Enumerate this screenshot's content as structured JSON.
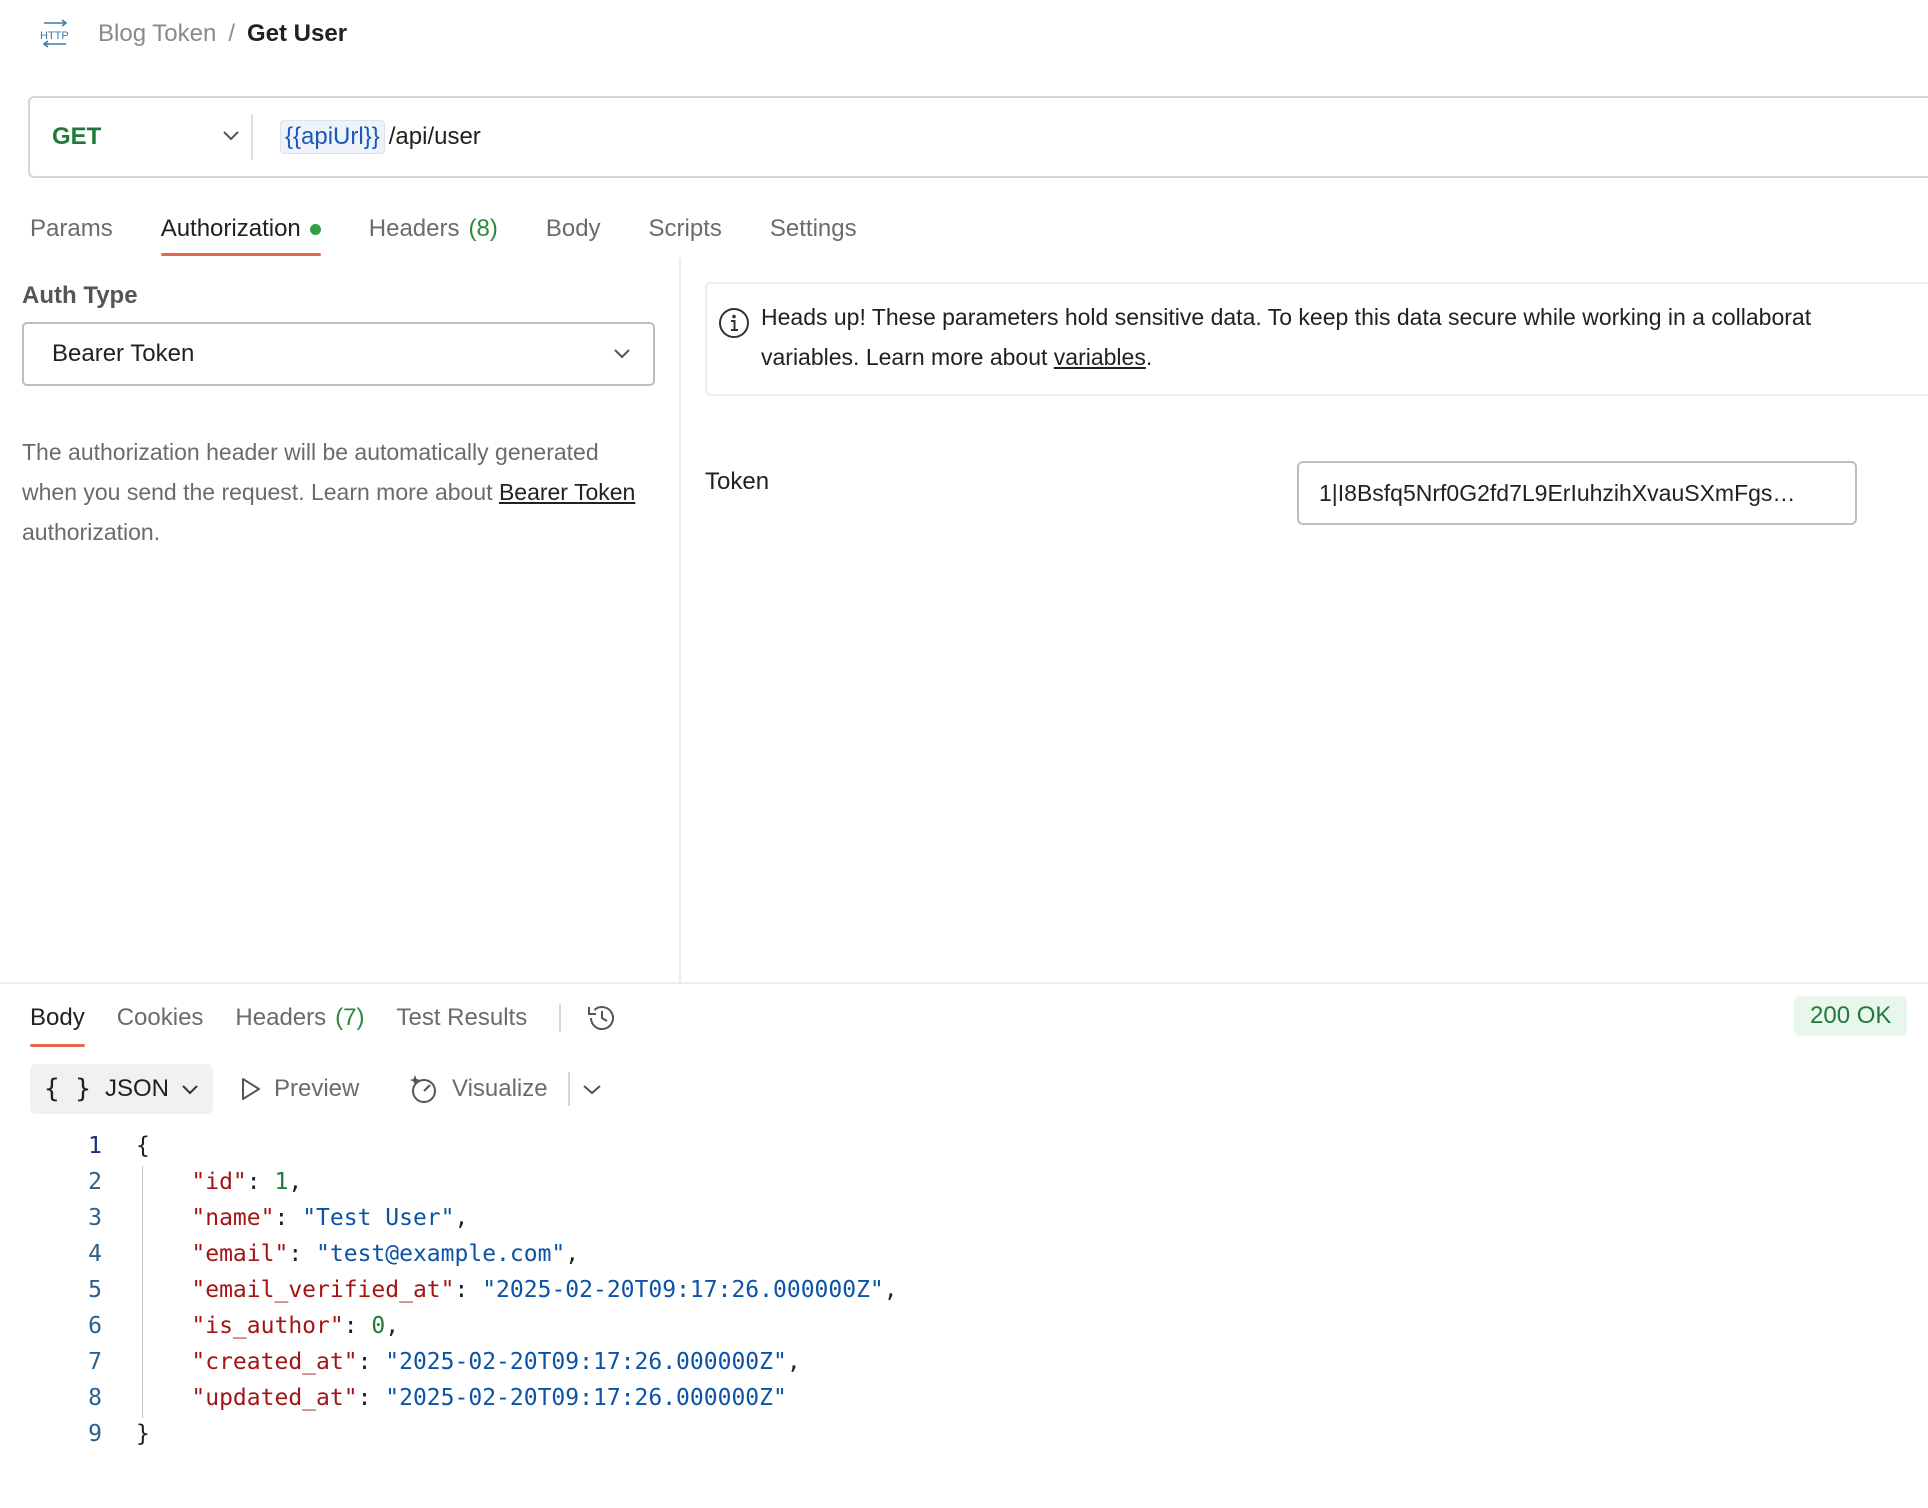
{
  "breadcrumb": {
    "icon": "http-icon",
    "parent": "Blog Token",
    "separator": "/",
    "current": "Get User"
  },
  "request": {
    "method": "GET",
    "url_variable": "{{apiUrl}}",
    "url_path": "/api/user"
  },
  "request_tabs": [
    {
      "label": "Params"
    },
    {
      "label": "Authorization",
      "active": true,
      "indicator": "green-dot"
    },
    {
      "label": "Headers",
      "count": "(8)"
    },
    {
      "label": "Body"
    },
    {
      "label": "Scripts"
    },
    {
      "label": "Settings"
    }
  ],
  "auth": {
    "type_label": "Auth Type",
    "type_value": "Bearer Token",
    "desc_prefix": "The authorization header will be automatically generated when you send the request. Learn more about",
    "desc_link": "Bearer Token",
    "desc_suffix": "authorization.",
    "notice_line1": "Heads up! These parameters hold sensitive data. To keep this data secure while working in a collaborat",
    "notice_line2_prefix": "variables. Learn more about",
    "notice_link": "variables",
    "notice_line2_suffix": ".",
    "token_label": "Token",
    "token_value": "1|I8Bsfq5Nrf0G2fd7L9ErIuhzihXvauSXmFgs…"
  },
  "response_tabs": [
    {
      "label": "Body",
      "active": true
    },
    {
      "label": "Cookies"
    },
    {
      "label": "Headers",
      "count": "(7)"
    },
    {
      "label": "Test Results"
    }
  ],
  "response_status": "200 OK",
  "toolbar": {
    "format_icon": "{ }",
    "format": "JSON",
    "preview": "Preview",
    "visualize": "Visualize"
  },
  "code_lines": [
    {
      "n": "1",
      "text": "{"
    },
    {
      "n": "2",
      "key": "\"id\"",
      "value": "1",
      "vtype": "num",
      "comma": ","
    },
    {
      "n": "3",
      "key": "\"name\"",
      "value": "\"Test User\"",
      "vtype": "str",
      "comma": ","
    },
    {
      "n": "4",
      "key": "\"email\"",
      "value": "\"test@example.com\"",
      "vtype": "str",
      "comma": ","
    },
    {
      "n": "5",
      "key": "\"email_verified_at\"",
      "value": "\"2025-02-20T09:17:26.000000Z\"",
      "vtype": "str",
      "comma": ","
    },
    {
      "n": "6",
      "key": "\"is_author\"",
      "value": "0",
      "vtype": "num",
      "comma": ","
    },
    {
      "n": "7",
      "key": "\"created_at\"",
      "value": "\"2025-02-20T09:17:26.000000Z\"",
      "vtype": "str",
      "comma": ","
    },
    {
      "n": "8",
      "key": "\"updated_at\"",
      "value": "\"2025-02-20T09:17:26.000000Z\"",
      "vtype": "str",
      "comma": ""
    },
    {
      "n": "9",
      "text": "}"
    }
  ],
  "colors": {
    "accent": "#e8694a",
    "success": "#1f7a3a",
    "variable": "#1c58b8"
  }
}
